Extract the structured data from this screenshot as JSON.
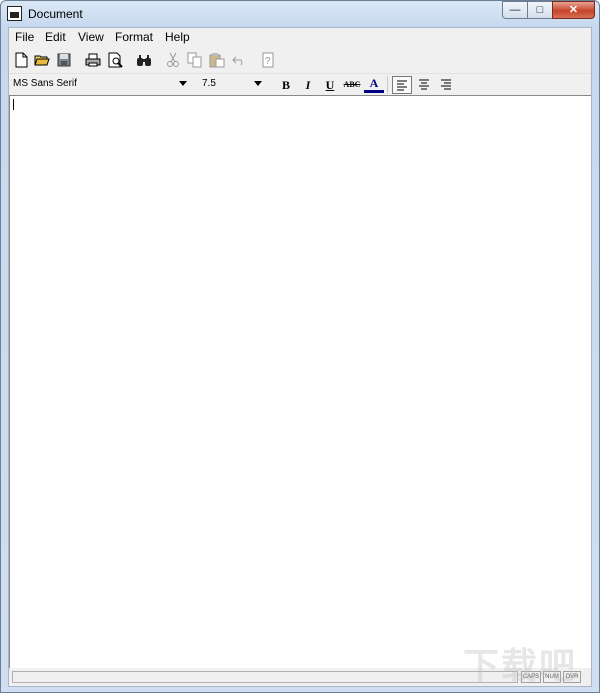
{
  "window": {
    "title": "Document"
  },
  "menu": [
    "File",
    "Edit",
    "View",
    "Format",
    "Help"
  ],
  "toolbar": [
    {
      "name": "new-icon"
    },
    {
      "name": "open-icon"
    },
    {
      "name": "save-icon"
    },
    {
      "name": "print-icon"
    },
    {
      "name": "print-preview-icon"
    },
    {
      "name": "find-icon"
    },
    {
      "name": "cut-icon"
    },
    {
      "name": "copy-icon"
    },
    {
      "name": "paste-icon"
    },
    {
      "name": "undo-icon"
    },
    {
      "name": "help-icon"
    }
  ],
  "format_bar": {
    "font": "MS Sans Serif",
    "size": "7.5",
    "bold": "B",
    "italic": "I",
    "underline": "U",
    "strike": "ABC",
    "color": "A",
    "align_left_active": true
  },
  "status": {
    "caps": "CAPS",
    "num": "NUM",
    "ovr": "OVR"
  },
  "watermark": "下载吧",
  "colors": {
    "title_gradient": "#c5d8ee",
    "close_button": "#c7442a",
    "text_color_underline": "#000080"
  }
}
